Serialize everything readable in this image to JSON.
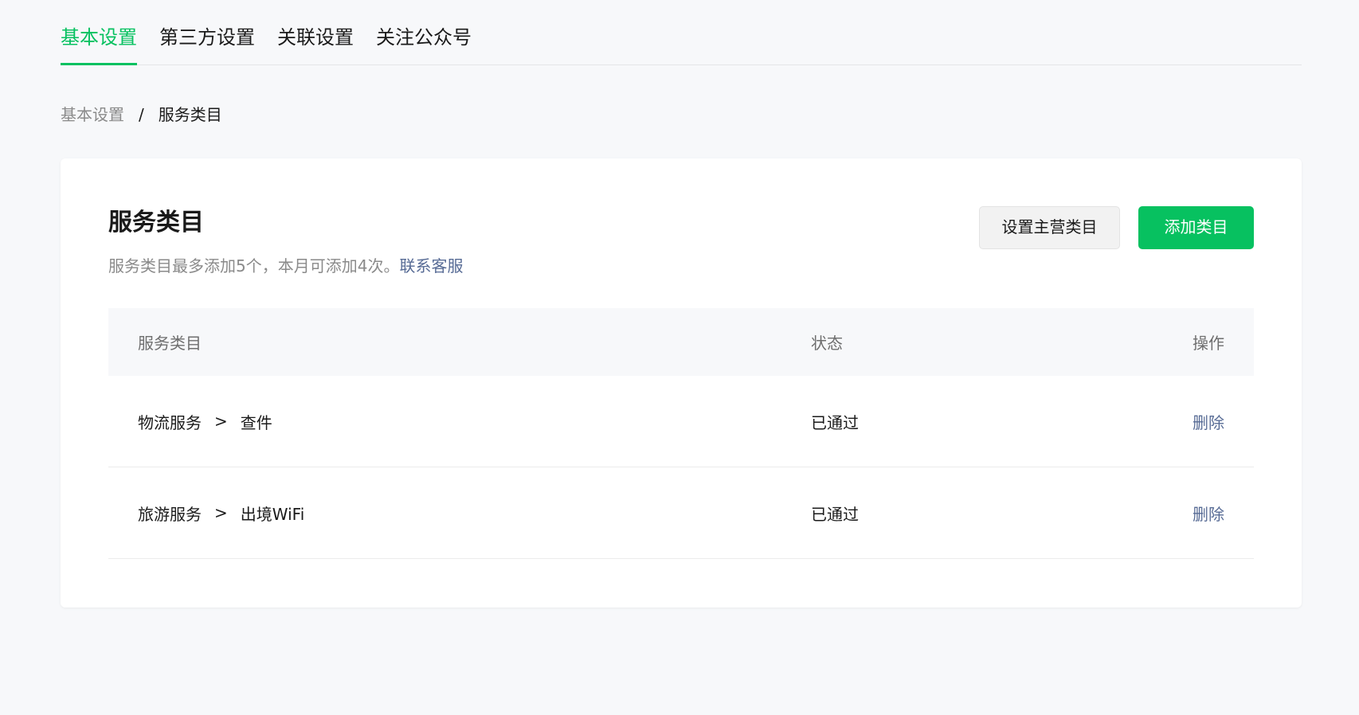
{
  "tabs": [
    {
      "label": "基本设置",
      "active": true
    },
    {
      "label": "第三方设置",
      "active": false
    },
    {
      "label": "关联设置",
      "active": false
    },
    {
      "label": "关注公众号",
      "active": false
    }
  ],
  "breadcrumb": {
    "parent": "基本设置",
    "separator": "/",
    "current": "服务类目"
  },
  "card": {
    "title": "服务类目",
    "desc_text": "服务类目最多添加5个，本月可添加4次。",
    "desc_link": "联系客服",
    "btn_set_main": "设置主营类目",
    "btn_add": "添加类目"
  },
  "table": {
    "headers": {
      "name": "服务类目",
      "status": "状态",
      "op": "操作"
    },
    "rows": [
      {
        "category": "物流服务",
        "arrow": ">",
        "sub": "查件",
        "status": "已通过",
        "op": "删除"
      },
      {
        "category": "旅游服务",
        "arrow": ">",
        "sub": "出境WiFi",
        "status": "已通过",
        "op": "删除"
      }
    ]
  },
  "colors": {
    "accent": "#07c160",
    "link": "#576b95",
    "background": "#f7f8fa"
  }
}
